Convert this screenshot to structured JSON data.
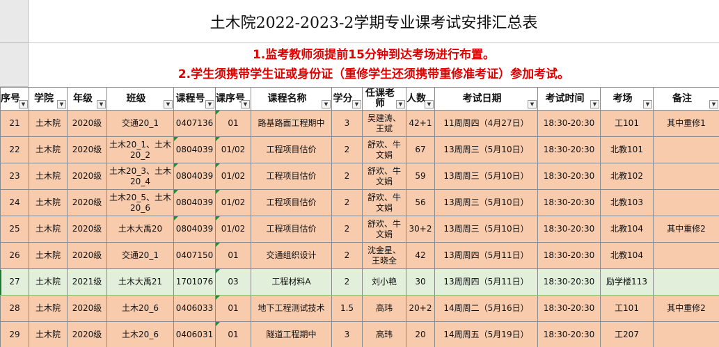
{
  "sheet": {
    "title": "土木院2022-2023-2学期专业课考试安排汇总表",
    "notices": [
      "1.监考教师须提前15分钟到达考场进行布置。",
      "2.学生须携带学生证或身份证（重修学生还须携带重修准考证）参加考试。"
    ],
    "filter_glyph": "▼",
    "columns": [
      "序号",
      "学院",
      "年级",
      "班级",
      "课程号",
      "课序号",
      "课程名称",
      "学分",
      "任课老师",
      "人数",
      "考试日期",
      "考试时间",
      "考场",
      "备注"
    ],
    "rows": [
      {
        "seq": "21",
        "college": "土木院",
        "grade": "2020级",
        "klass": "交通20_1",
        "course_no": "0407136",
        "course_seq": "01",
        "course_name": "路基路面工程期中",
        "credit": "3",
        "teacher": "吴建涛、王斌",
        "count": "42+1",
        "date": "11周周四（4月27日）",
        "time": "18:30-20:30",
        "room": "工101",
        "note": "其中重修1"
      },
      {
        "seq": "22",
        "college": "土木院",
        "grade": "2020级",
        "klass": "土木20_1、土木20_2",
        "course_no": "0804039",
        "course_seq": "01/02",
        "course_name": "工程项目估价",
        "credit": "2",
        "teacher": "舒欢、牛文娟",
        "count": "67",
        "date": "13周周三（5月10日）",
        "time": "18:30-20:30",
        "room": "北教101",
        "note": ""
      },
      {
        "seq": "23",
        "college": "土木院",
        "grade": "2020级",
        "klass": "土木20_3、土木20_4",
        "course_no": "0804039",
        "course_seq": "01/02",
        "course_name": "工程项目估价",
        "credit": "2",
        "teacher": "舒欢、牛文娟",
        "count": "59",
        "date": "13周周三（5月10日）",
        "time": "18:30-20:30",
        "room": "北教102",
        "note": ""
      },
      {
        "seq": "24",
        "college": "土木院",
        "grade": "2020级",
        "klass": "土木20_5、土木20_6",
        "course_no": "0804039",
        "course_seq": "01/02",
        "course_name": "工程项目估价",
        "credit": "2",
        "teacher": "舒欢、牛文娟",
        "count": "56",
        "date": "13周周三（5月10日）",
        "time": "18:30-20:30",
        "room": "北教103",
        "note": ""
      },
      {
        "seq": "25",
        "college": "土木院",
        "grade": "2020级",
        "klass": "土木大禹20",
        "course_no": "0804039",
        "course_seq": "01/02",
        "course_name": "工程项目估价",
        "credit": "2",
        "teacher": "舒欢、牛文娟",
        "count": "30+2",
        "date": "13周周三（5月10日）",
        "time": "18:30-20:30",
        "room": "北教104",
        "note": "其中重修2"
      },
      {
        "seq": "26",
        "college": "土木院",
        "grade": "2020级",
        "klass": "交通20_1",
        "course_no": "0407150",
        "course_seq": "01",
        "course_name": "交通组织设计",
        "credit": "2",
        "teacher": "沈金星、王晓全",
        "count": "42",
        "date": "13周周四（5月11日）",
        "time": "18:30-20:30",
        "room": "北教104",
        "note": ""
      },
      {
        "seq": "27",
        "college": "土木院",
        "grade": "2021级",
        "klass": "土木大禹21",
        "course_no": "1701076",
        "course_seq": "03",
        "course_name": "工程材料A",
        "credit": "2",
        "teacher": "刘小艳",
        "count": "30",
        "date": "13周周四（5月11日）",
        "time": "18:30-20:30",
        "room": "励学楼113",
        "note": ""
      },
      {
        "seq": "28",
        "college": "土木院",
        "grade": "2020级",
        "klass": "土木20_6",
        "course_no": "0406033",
        "course_seq": "01",
        "course_name": "地下工程测试技术",
        "credit": "1.5",
        "teacher": "高玮",
        "count": "20+2",
        "date": "14周周二（5月16日）",
        "time": "18:30-20:30",
        "room": "工101",
        "note": "其中重修2"
      },
      {
        "seq": "29",
        "college": "土木院",
        "grade": "2020级",
        "klass": "土木20_6",
        "course_no": "0406031",
        "course_seq": "01",
        "course_name": "隧道工程期中",
        "credit": "3",
        "teacher": "高玮",
        "count": "20",
        "date": "14周周五（5月19日）",
        "time": "18:30-20:30",
        "room": "工207",
        "note": ""
      }
    ]
  },
  "colors": {
    "row_fill": "#f8cbad",
    "selected_row_fill": "#e2efda",
    "notice_text": "#e00000",
    "error_flag": "#1e8f3a"
  }
}
